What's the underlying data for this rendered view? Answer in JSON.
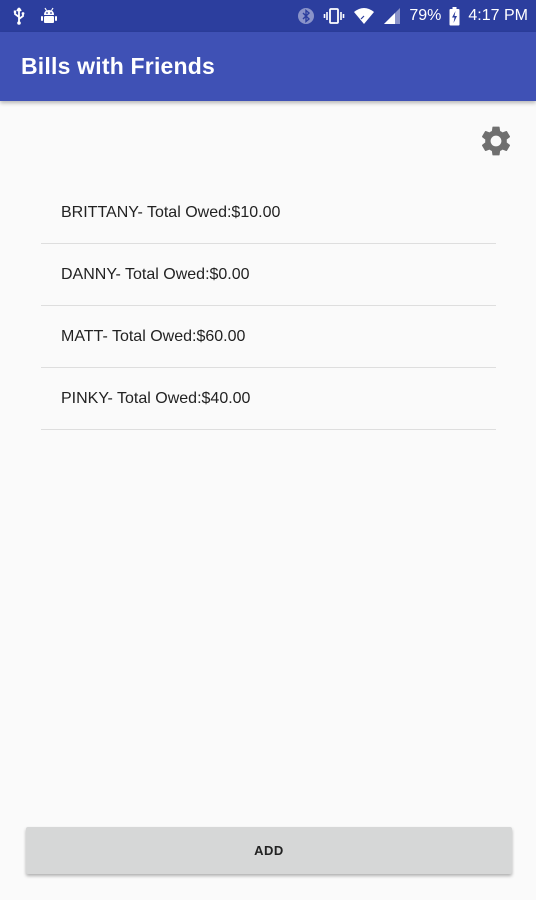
{
  "status_bar": {
    "battery_percent": "79%",
    "time": "4:17 PM",
    "icons": [
      "usb-icon",
      "android-debug-icon",
      "bluetooth-icon",
      "vibrate-icon",
      "wifi-icon",
      "signal-icon",
      "battery-charging-icon"
    ]
  },
  "app_bar": {
    "title": "Bills with Friends",
    "color": "#3f51b5",
    "status_color": "#2c3e9e"
  },
  "settings": {
    "icon": "gear-icon"
  },
  "friends": [
    {
      "label": "BRITTANY- Total Owed:$10.00"
    },
    {
      "label": "DANNY- Total Owed:$0.00"
    },
    {
      "label": "MATT- Total Owed:$60.00"
    },
    {
      "label": "PINKY- Total Owed:$40.00"
    }
  ],
  "actions": {
    "add_label": "ADD"
  }
}
